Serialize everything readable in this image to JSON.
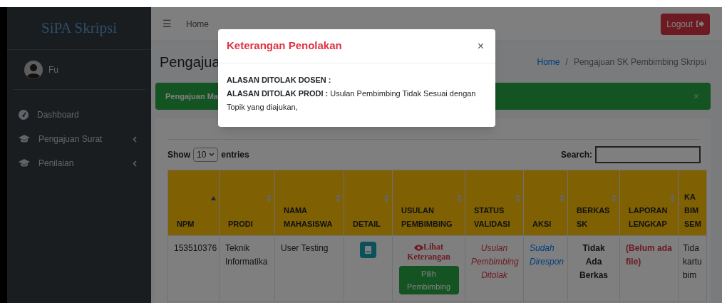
{
  "sidebar": {
    "brand": "SiPA Skripsi",
    "user": "Fu",
    "items": [
      {
        "label": "Dashboard",
        "has_submenu": false
      },
      {
        "label": "Pengajuan Surat",
        "has_submenu": true
      },
      {
        "label": "Penilaian",
        "has_submenu": true
      }
    ]
  },
  "navbar": {
    "menu_icon": "☰",
    "link": "Home",
    "logout": "Logout"
  },
  "page": {
    "title": "Pengajua",
    "breadcrumb": [
      "Home",
      "/",
      "Pengajuan SK Pembimbing Skripsi"
    ],
    "alert": "Pengajuan Ma",
    "alert_close": "×"
  },
  "table_controls": {
    "show": "Show",
    "page_size": "10",
    "entries": "entries",
    "search_label": "Search:"
  },
  "table": {
    "columns": [
      {
        "label": "NPM",
        "sorted": true
      },
      {
        "label": "PRODI",
        "sorted": false
      },
      {
        "label": "NAMA MAHASISWA",
        "sorted": false
      },
      {
        "label": "DETAIL",
        "sorted": false
      },
      {
        "label": "USULAN PEMBIMBING",
        "sorted": false
      },
      {
        "label": "STATUS VALIDASI",
        "sorted": false
      },
      {
        "label": "AKSI",
        "sorted": false
      },
      {
        "label": "BERKAS SK",
        "sorted": false
      },
      {
        "label": "LAPORAN LENGKAP",
        "sorted": false
      },
      {
        "label": "KA\nBIM\nSEM"
      }
    ],
    "rows": [
      {
        "cells": [
          {
            "kind": "plain",
            "text": "153510376"
          },
          {
            "kind": "plain",
            "text": "Teknik Informatika"
          },
          {
            "kind": "plain",
            "text": "User Testing"
          },
          {
            "kind": "detail_button"
          },
          {
            "kind": "proposal",
            "link": "Lihat Keterangan",
            "button": "Pilih Pembimbing"
          },
          {
            "kind": "rejected",
            "text": "Usulan Pembimbing Ditolak"
          },
          {
            "kind": "responded",
            "text": "Sudah Direspon"
          },
          {
            "kind": "bold",
            "text": "Tidak Ada Berkas"
          },
          {
            "kind": "missing",
            "text": "(Belum ada file)"
          },
          {
            "kind": "lines",
            "text": "Tida\nkartu\nbim"
          }
        ]
      }
    ]
  },
  "modal": {
    "title": "Keterangan Penolakan",
    "close": "×",
    "lines": [
      "**ALASAN DITOLAK DOSEN :**",
      "**ALASAN DITOLAK PRODI :** Usulan Pembimbing Tidak Sesuai dengan Topik yang diajukan,"
    ]
  }
}
